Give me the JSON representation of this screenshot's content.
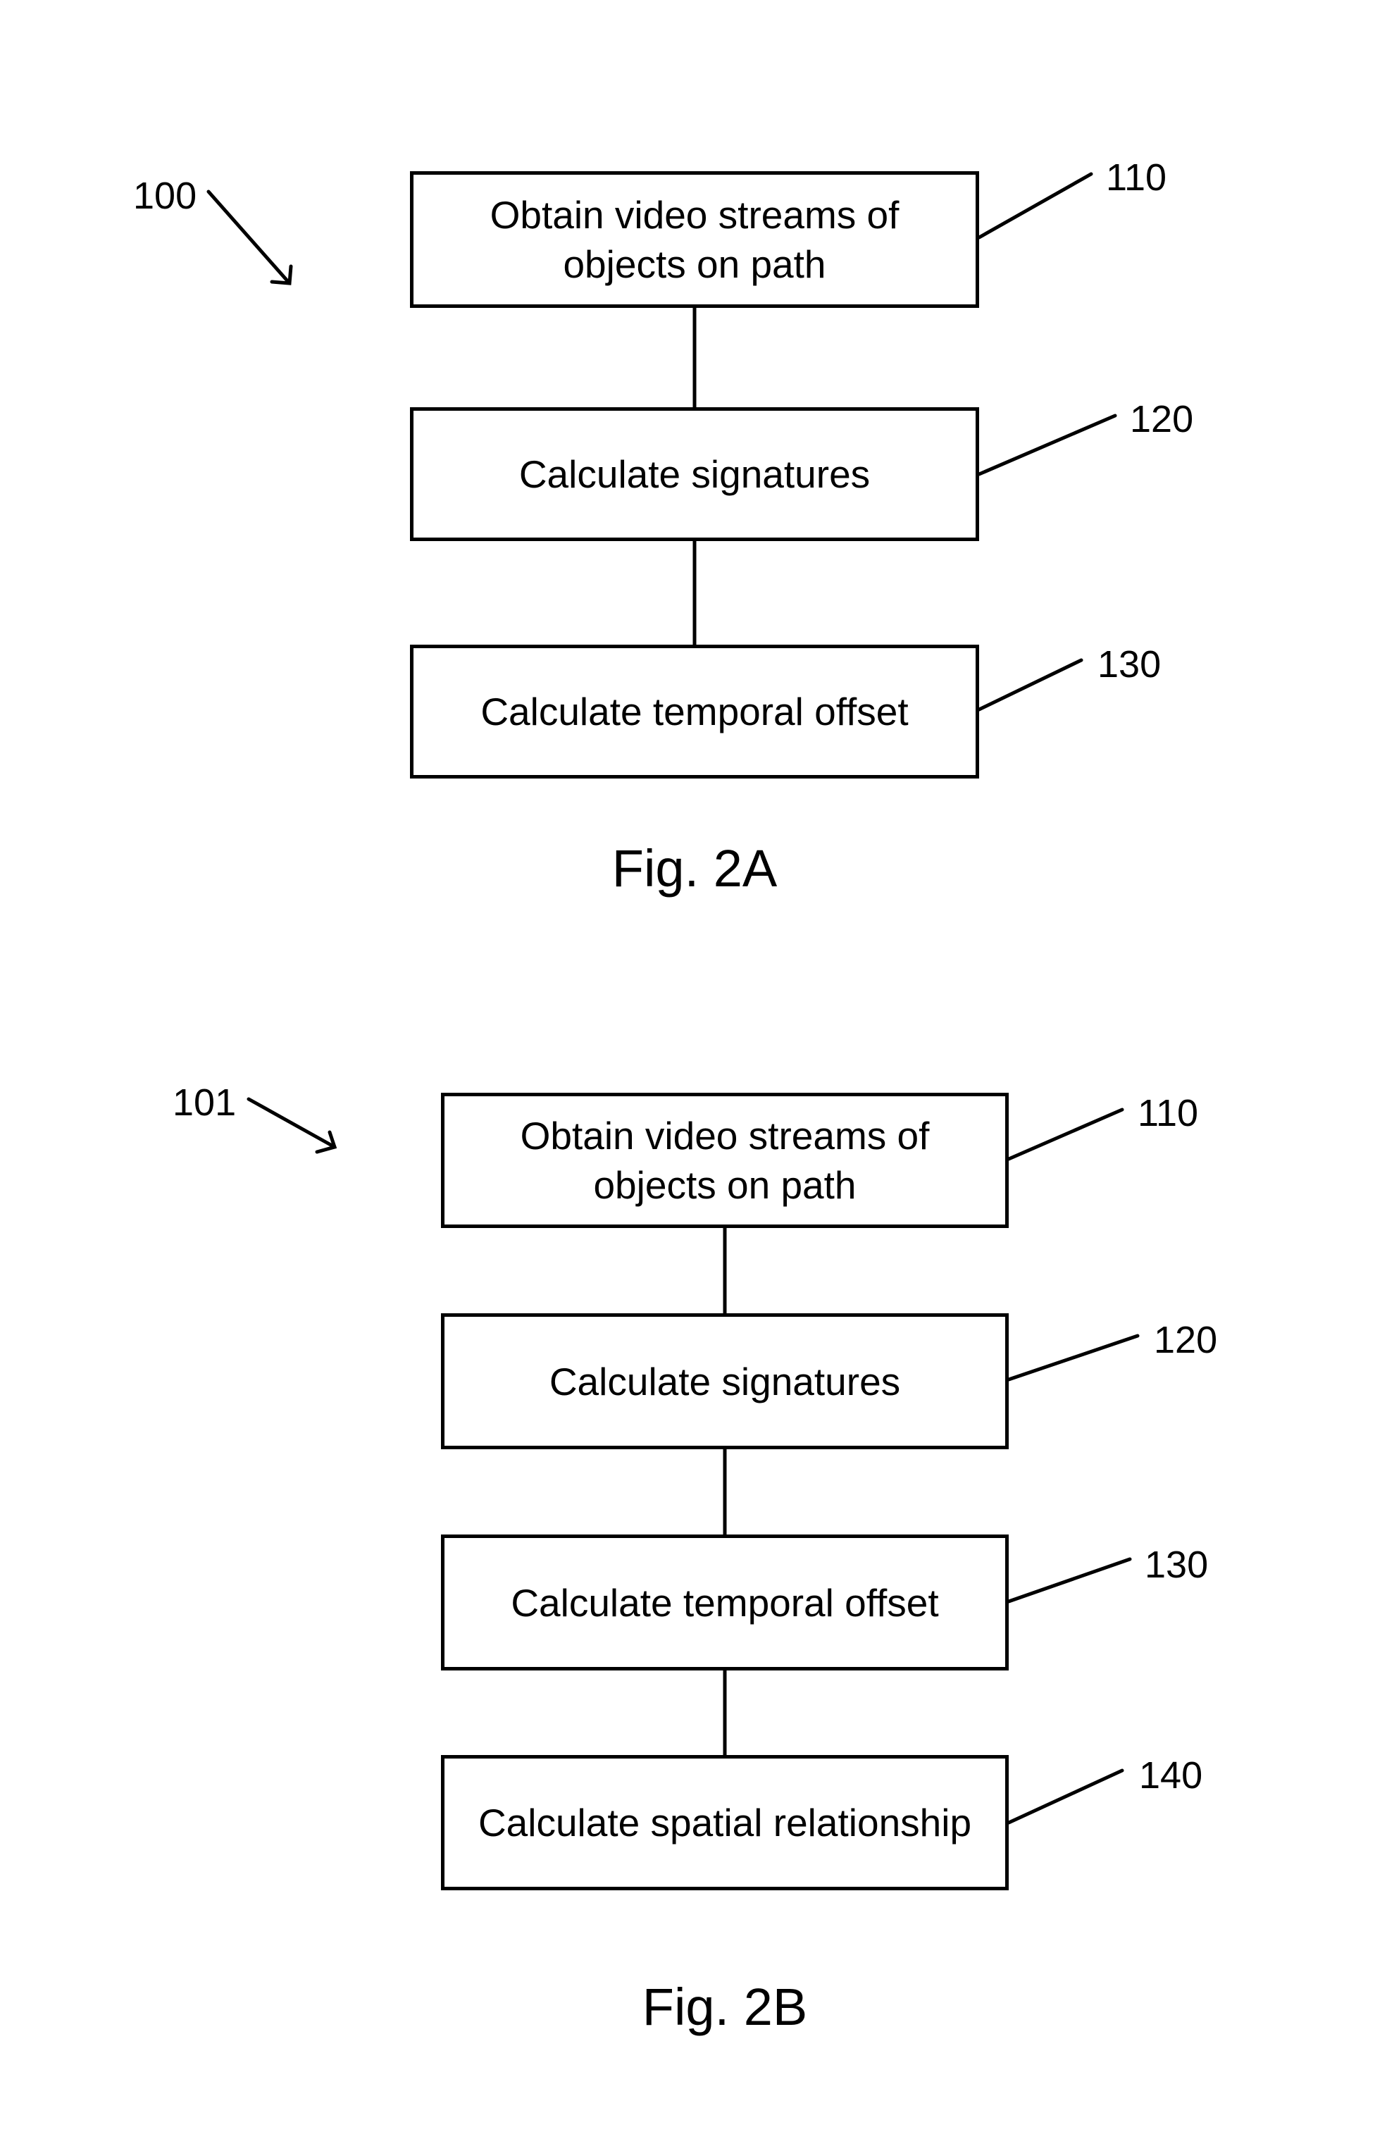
{
  "figures": [
    {
      "id": "fig-2a",
      "label": "100",
      "caption": "Fig. 2A",
      "steps": [
        {
          "ref": "110",
          "text": "Obtain video streams of\nobjects on path"
        },
        {
          "ref": "120",
          "text": "Calculate signatures"
        },
        {
          "ref": "130",
          "text": "Calculate temporal offset"
        }
      ]
    },
    {
      "id": "fig-2b",
      "label": "101",
      "caption": "Fig. 2B",
      "steps": [
        {
          "ref": "110",
          "text": "Obtain video streams of\nobjects on path"
        },
        {
          "ref": "120",
          "text": "Calculate signatures"
        },
        {
          "ref": "130",
          "text": "Calculate temporal offset"
        },
        {
          "ref": "140",
          "text": "Calculate spatial relationship"
        }
      ]
    }
  ],
  "colors": {
    "stroke": "#000000",
    "background": "#ffffff"
  }
}
